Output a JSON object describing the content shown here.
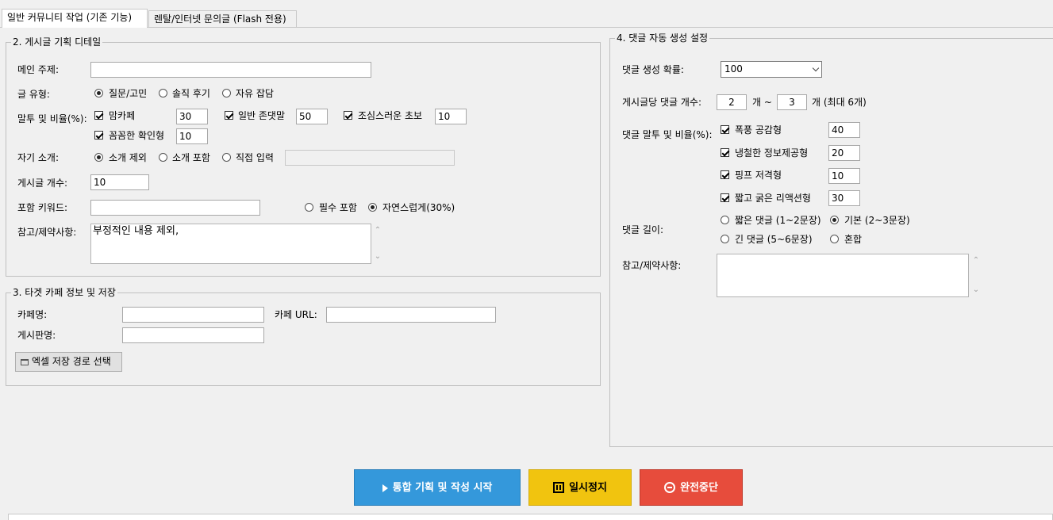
{
  "tabs": [
    {
      "label": "일반 커뮤니티 작업 (기존 기능)",
      "active": true
    },
    {
      "label": "렌탈/인터넷 문의글 (Flash 전용)",
      "active": false
    }
  ],
  "section2": {
    "title": "2. 게시글 기획 디테일",
    "main_topic_label": "메인 주제:",
    "main_topic_value": "",
    "post_type_label": "글 유형:",
    "post_types": [
      "질문/고민",
      "솔직 후기",
      "자유 잡담"
    ],
    "post_type_selected": 0,
    "tone_label": "말투 및 비율(%):",
    "tones": [
      {
        "label": "맘카페",
        "value": "30",
        "checked": true
      },
      {
        "label": "일반 존댓말",
        "value": "50",
        "checked": true
      },
      {
        "label": "조심스러운 초보",
        "value": "10",
        "checked": true
      },
      {
        "label": "꼼꼼한 확인형",
        "value": "10",
        "checked": true
      }
    ],
    "self_intro_label": "자기 소개:",
    "self_intro_options": [
      "소개 제외",
      "소개 포함",
      "직접 입력"
    ],
    "self_intro_selected": 0,
    "self_intro_custom_value": "",
    "post_count_label": "게시글 개수:",
    "post_count_value": "10",
    "keyword_label": "포함 키워드:",
    "keyword_value": "",
    "keyword_modes": [
      "필수 포함",
      "자연스럽게(30%)"
    ],
    "keyword_mode_selected": 1,
    "notes_label": "참고/제약사항:",
    "notes_value": "부정적인 내용 제외,"
  },
  "section3": {
    "title": "3. 타겟 카페 정보 및 저장",
    "cafe_name_label": "카페명:",
    "cafe_name_value": "",
    "cafe_url_label": "카페 URL:",
    "cafe_url_value": "",
    "board_name_label": "게시판명:",
    "board_name_value": "",
    "excel_path_button": "엑셀 저장 경로 선택"
  },
  "section4": {
    "title": "4. 댓글 자동 생성 설정",
    "probability_label": "댓글 생성 확률:",
    "probability_value": "100",
    "count_label": "게시글당 댓글 개수:",
    "count_min": "2",
    "count_sep": "개 ~",
    "count_max": "3",
    "count_suffix": "개 (최대 6개)",
    "tone_label": "댓글 말투 및 비율(%):",
    "tones": [
      {
        "label": "폭풍 공감형",
        "value": "40",
        "checked": true
      },
      {
        "label": "냉철한 정보제공형",
        "value": "20",
        "checked": true
      },
      {
        "label": "핑프 저격형",
        "value": "10",
        "checked": true
      },
      {
        "label": "짧고 굵은 리액션형",
        "value": "30",
        "checked": true
      }
    ],
    "length_label": "댓글 길이:",
    "length_options": [
      "짧은 댓글 (1~2문장)",
      "기본 (2~3문장)",
      "긴 댓글 (5~6문장)",
      "혼합"
    ],
    "length_selected": 1,
    "notes_label": "참고/제약사항:",
    "notes_value": ""
  },
  "actions": {
    "start": "통합 기획 및 작성 시작",
    "pause": "일시정지",
    "stop": "완전중단"
  },
  "colors": {
    "start": "#3498db",
    "pause": "#f1c40f",
    "stop": "#e74c3c"
  }
}
